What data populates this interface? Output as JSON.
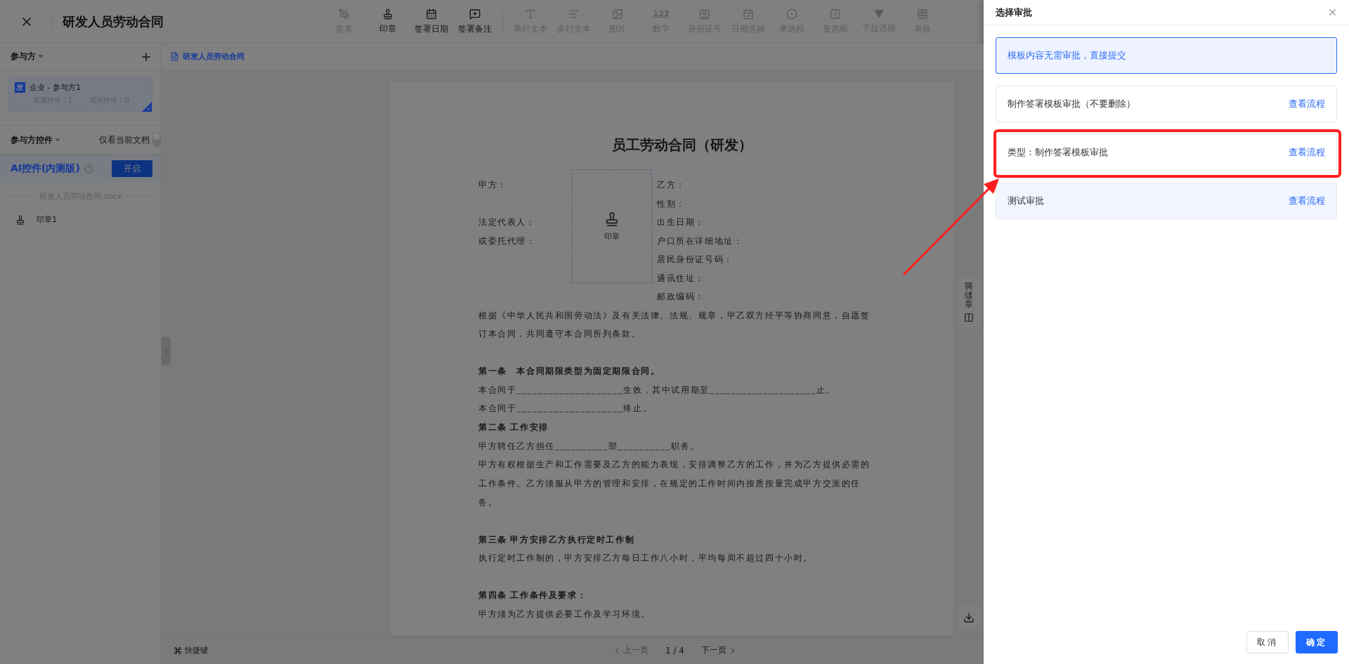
{
  "header": {
    "title": "研发人员劳动合同"
  },
  "toolbar": [
    {
      "label": "签名",
      "disabled": true
    },
    {
      "label": "印章",
      "disabled": false
    },
    {
      "label": "签署日期",
      "disabled": false
    },
    {
      "label": "签署备注",
      "disabled": false
    },
    {
      "label": "单行文本",
      "disabled": true
    },
    {
      "label": "多行文本",
      "disabled": true
    },
    {
      "label": "图片",
      "disabled": true
    },
    {
      "label": "数字",
      "disabled": true,
      "glyph": "123"
    },
    {
      "label": "身份证号",
      "disabled": true
    },
    {
      "label": "日期选择",
      "disabled": true
    },
    {
      "label": "单选框",
      "disabled": true
    },
    {
      "label": "复选框",
      "disabled": true
    },
    {
      "label": "下拉选择",
      "disabled": true
    },
    {
      "label": "表格",
      "disabled": true
    }
  ],
  "doc_tab": {
    "label": "研发人员劳动合同"
  },
  "sidebar": {
    "participants_title": "参与方",
    "participants": [
      {
        "badge": "发",
        "name": "企业 - 参与方1",
        "sign_count": "签署控件：1",
        "fill_count": "填写控件：0",
        "selected": true
      }
    ],
    "controls_title": "参与方控件",
    "toggle": {
      "label": "仅看当前文档",
      "on": false
    },
    "ai": {
      "label": "AI控件(内测版)",
      "button": "开启"
    },
    "file_name": "研发人员劳动合同.docx",
    "items": [
      {
        "label": "印章1"
      }
    ]
  },
  "document": {
    "title": "员工劳动合同（研发）",
    "stamp_label": "印章",
    "party_rows": [
      {
        "left": "甲方：",
        "right": "乙方："
      },
      {
        "right": "性别："
      },
      {
        "left": "法定代表人：",
        "right": "出生日期："
      },
      {
        "left": "或委托代理：",
        "right": "户口所在详细地址："
      },
      {
        "right": "居民身份证号码："
      },
      {
        "right": "通讯住址："
      },
      {
        "right": "邮政编码："
      }
    ],
    "blocks": [
      {
        "kind": "para",
        "text": "根据《中华人民共和国劳动法》及有关法律、法规、规章，甲乙双方经平等协商同意，自愿签订本合同，共同遵守本合同所列条款。"
      },
      {
        "kind": "heading",
        "space_before": true,
        "text": "第一条　本合同期限类型为固定期限合同。"
      },
      {
        "kind": "para",
        "text": "本合同于____________________生效，其中试用期至____________________止。"
      },
      {
        "kind": "para",
        "text": "本合同于____________________终止。"
      },
      {
        "kind": "heading",
        "space_before": false,
        "text": "第二条 工作安排"
      },
      {
        "kind": "para",
        "text": "甲方聘任乙方担任__________部__________职务。"
      },
      {
        "kind": "para",
        "text": "甲方有权根据生产和工作需要及乙方的能力表现，安排调整乙方的工作，并为乙方提供必需的工作条件。乙方须服从甲方的管理和安排，在规定的工作时间内按质按量完成甲方交派的任务。"
      },
      {
        "kind": "heading",
        "space_before": true,
        "text": "第三条 甲方安排乙方执行定时工作制"
      },
      {
        "kind": "para",
        "text": "执行定时工作制的，甲方安排乙方每日工作八小时，平均每周不超过四十小时。"
      },
      {
        "kind": "heading",
        "space_before": true,
        "text": "第四条 工作条件及要求："
      },
      {
        "kind": "para",
        "text": "甲方须为乙方提供必要工作及学习环境。"
      }
    ]
  },
  "side_tools": {
    "seal_label": "骑缝章"
  },
  "bottom_bar": {
    "shortcut": "快捷键",
    "prev": "上一页",
    "prev_disabled": true,
    "page": "1 / 4",
    "next": "下一页"
  },
  "drawer": {
    "title": "选择审批",
    "options": [
      {
        "text": "模板内容无需审批，直接提交",
        "selected": true,
        "highlighted": false,
        "annotated": false
      },
      {
        "text": "制作签署模板审批（不要删除）",
        "link": "查看流程",
        "selected": false,
        "highlighted": false,
        "annotated": false
      },
      {
        "text": "类型：制作签署模板审批",
        "link": "查看流程",
        "selected": false,
        "highlighted": false,
        "annotated": true
      },
      {
        "text": "测试审批",
        "link": "查看流程",
        "selected": false,
        "highlighted": true,
        "annotated": false
      }
    ],
    "cancel": "取消",
    "confirm": "确定"
  }
}
